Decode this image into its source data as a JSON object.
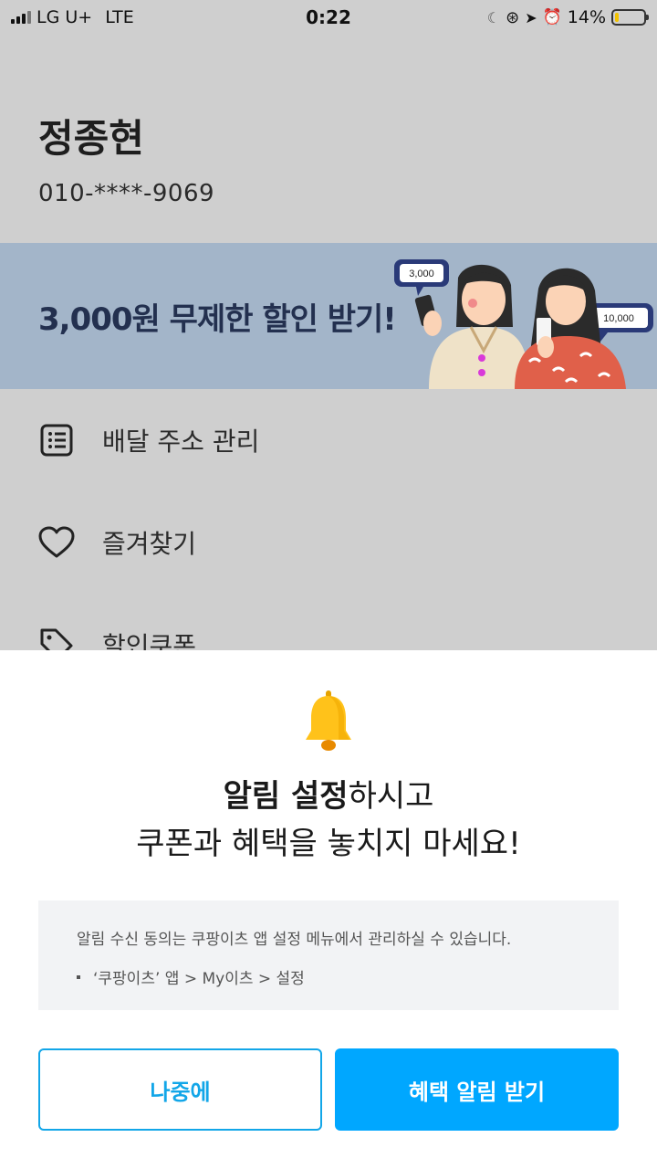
{
  "status_bar": {
    "carrier": "LG U+",
    "network": "LTE",
    "time": "0:22",
    "battery": "14%",
    "battery_level": 0.14
  },
  "profile": {
    "name": "정종현",
    "phone": "010-****-9069"
  },
  "banner": {
    "text": "3,000원 무제한 할인 받기!",
    "bubble_left": "3,000",
    "bubble_right": "10,000"
  },
  "menu": [
    {
      "label": "배달 주소 관리",
      "icon": "address-list-icon"
    },
    {
      "label": "즐겨찾기",
      "icon": "heart-icon"
    },
    {
      "label": "할인쿠폰",
      "icon": "tag-icon"
    }
  ],
  "sheet": {
    "title_bold": "알림 설정",
    "title_rest": "하시고",
    "title_line2": "쿠폰과 혜택을 놓치지 마세요!",
    "info": "알림 수신 동의는 쿠팡이츠 앱 설정 메뉴에서 관리하실 수 있습니다.",
    "info_path": "‘쿠팡이츠’ 앱 > My이츠 > 설정",
    "later_label": "나중에",
    "agree_label": "혜택 알림 받기"
  },
  "colors": {
    "accent": "#00a7ff",
    "banner_bg": "#a3b5c9",
    "overlay": "#cfcfcf"
  }
}
